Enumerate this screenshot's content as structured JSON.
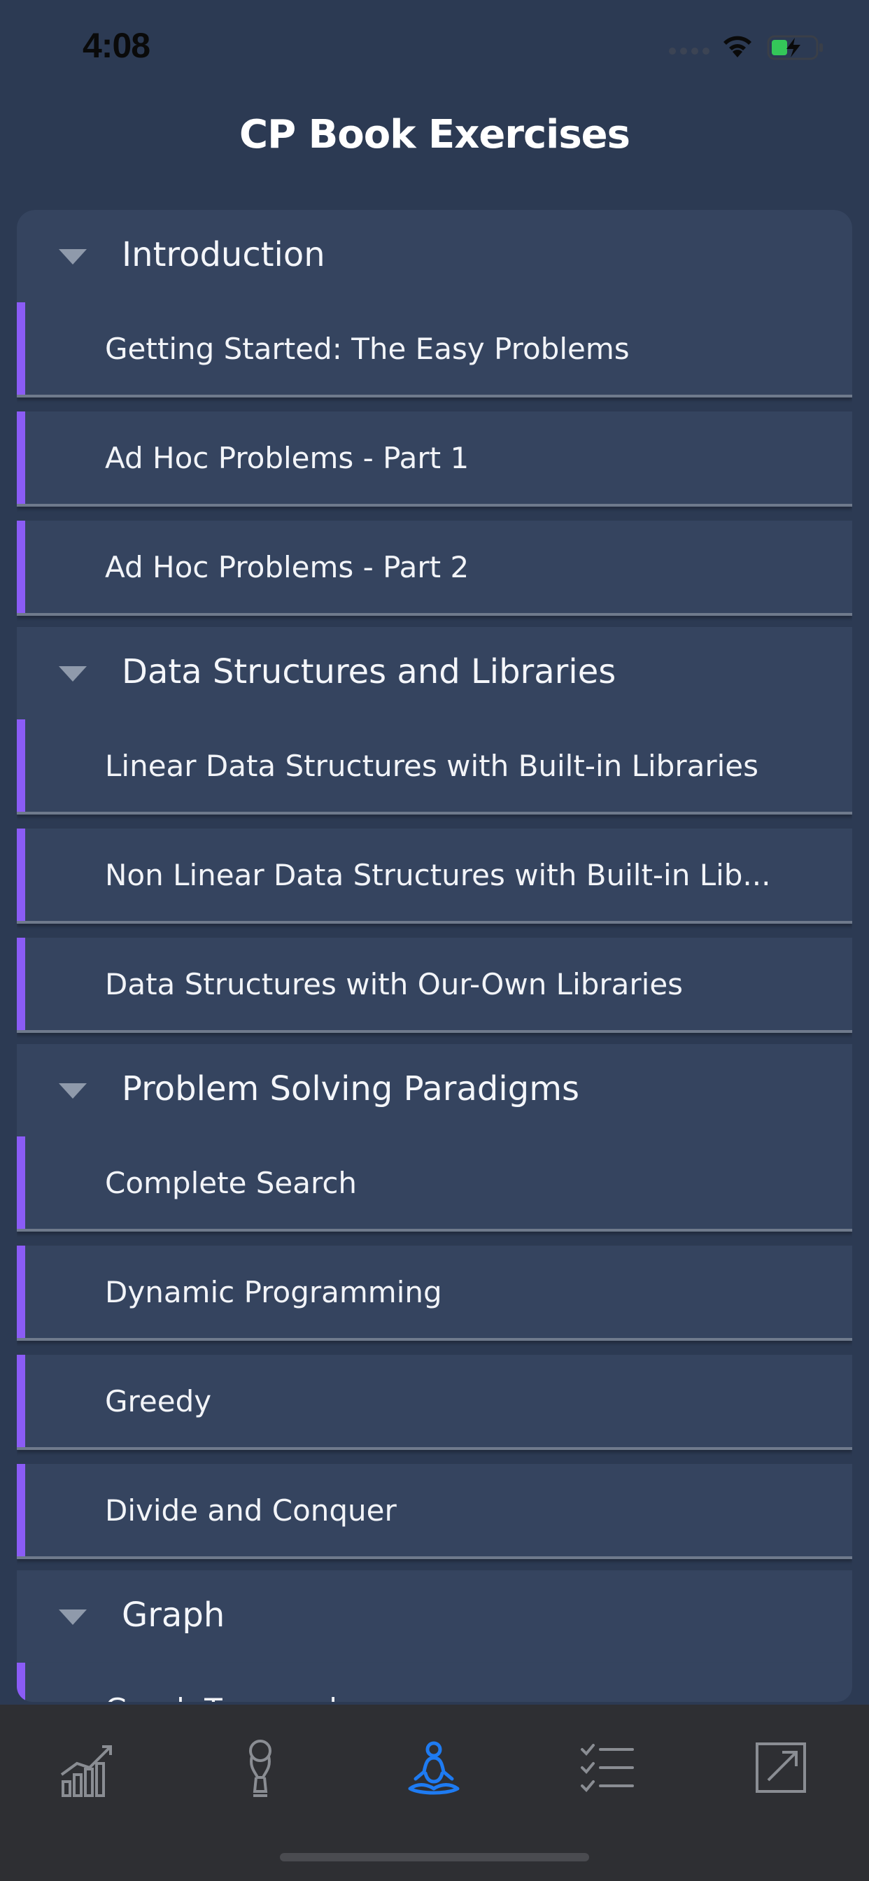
{
  "status_bar": {
    "time": "4:08"
  },
  "header": {
    "title": "CP Book Exercises"
  },
  "sections": [
    {
      "title": "Introduction",
      "items": [
        {
          "label": "Getting Started: The Easy Problems"
        },
        {
          "label": "Ad Hoc Problems - Part 1"
        },
        {
          "label": "Ad Hoc Problems - Part 2"
        }
      ]
    },
    {
      "title": "Data Structures and Libraries",
      "items": [
        {
          "label": "Linear Data Structures with Built-in Libraries"
        },
        {
          "label": "Non Linear Data Structures with Built-in Lib..."
        },
        {
          "label": "Data Structures with Our-Own Libraries"
        }
      ]
    },
    {
      "title": "Problem Solving Paradigms",
      "items": [
        {
          "label": "Complete Search"
        },
        {
          "label": "Dynamic Programming"
        },
        {
          "label": "Greedy"
        },
        {
          "label": "Divide and Conquer"
        }
      ]
    },
    {
      "title": "Graph",
      "items": [
        {
          "label": "Graph Traversal"
        }
      ]
    }
  ],
  "tab_bar": {
    "tabs": [
      {
        "icon": "stats-chart-icon",
        "active": false
      },
      {
        "icon": "trophy-icon",
        "active": false
      },
      {
        "icon": "meditation-icon",
        "active": true
      },
      {
        "icon": "checklist-icon",
        "active": false
      },
      {
        "icon": "external-link-icon",
        "active": false
      }
    ]
  },
  "colors": {
    "background": "#2c3a53",
    "card": "#35445f",
    "accent_bar": "#8b5cf6",
    "active_tab": "#1e7bf2",
    "inactive_tab": "#8a8d93",
    "tab_bar_bg": "#2e2f33"
  }
}
